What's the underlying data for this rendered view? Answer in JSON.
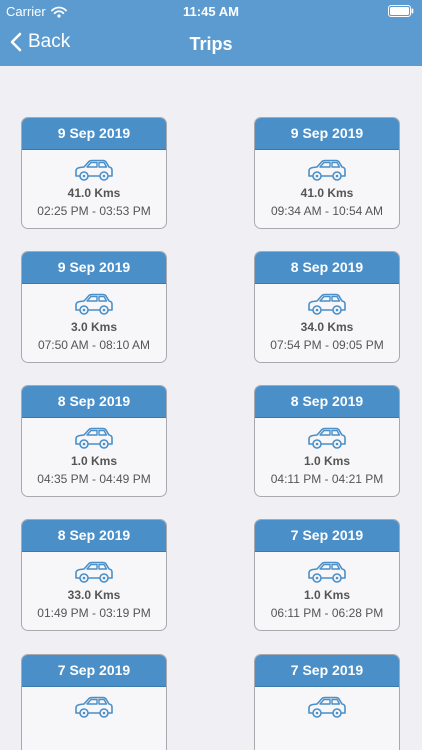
{
  "status": {
    "carrier": "Carrier",
    "time": "11:45 AM"
  },
  "nav": {
    "back_label": "Back",
    "title": "Trips"
  },
  "trips": [
    {
      "date": "9 Sep 2019",
      "distance": "41.0 Kms",
      "time_range": "02:25 PM - 03:53 PM"
    },
    {
      "date": "9 Sep 2019",
      "distance": "41.0 Kms",
      "time_range": "09:34 AM - 10:54 AM"
    },
    {
      "date": "9 Sep 2019",
      "distance": "3.0 Kms",
      "time_range": "07:50 AM - 08:10 AM"
    },
    {
      "date": "8 Sep 2019",
      "distance": "34.0 Kms",
      "time_range": "07:54 PM - 09:05 PM"
    },
    {
      "date": "8 Sep 2019",
      "distance": "1.0 Kms",
      "time_range": "04:35 PM - 04:49 PM"
    },
    {
      "date": "8 Sep 2019",
      "distance": "1.0 Kms",
      "time_range": "04:11 PM - 04:21 PM"
    },
    {
      "date": "8 Sep 2019",
      "distance": "33.0 Kms",
      "time_range": "01:49 PM - 03:19 PM"
    },
    {
      "date": "7 Sep 2019",
      "distance": "1.0 Kms",
      "time_range": "06:11 PM - 06:28 PM"
    },
    {
      "date": "7 Sep 2019",
      "distance": "",
      "time_range": ""
    },
    {
      "date": "7 Sep 2019",
      "distance": "",
      "time_range": ""
    }
  ],
  "icons": {
    "back": "chevron-left-icon",
    "wifi": "wifi-icon",
    "battery": "battery-icon",
    "car": "car-icon"
  },
  "colors": {
    "nav_bar": "#5b9bd0",
    "card_header": "#4a8fc8",
    "background": "#efeff4",
    "car_icon": "#4a8fc8"
  }
}
